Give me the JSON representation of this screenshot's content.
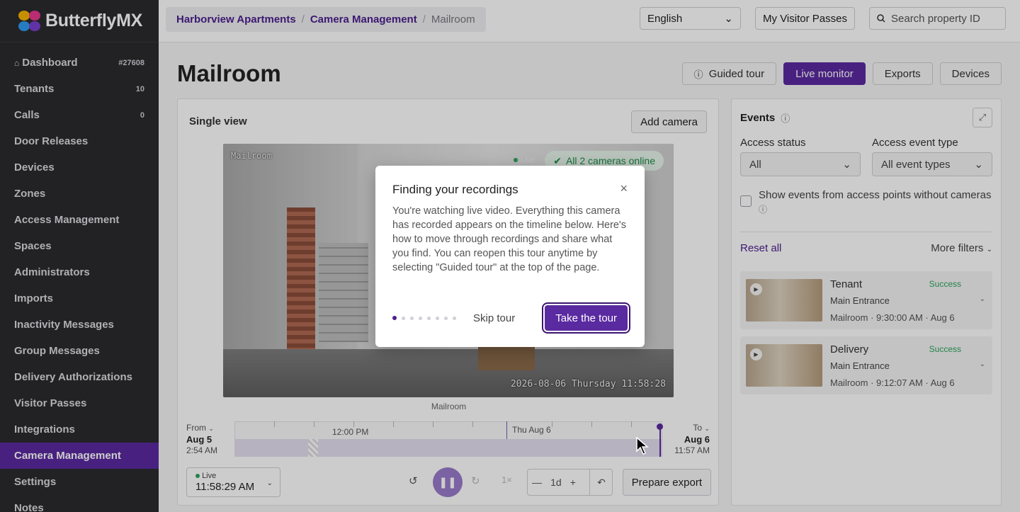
{
  "brand": {
    "name": "ButterflyMX"
  },
  "sidebar": {
    "items": [
      {
        "label": "Dashboard",
        "count": "#27608",
        "icon": "home-icon"
      },
      {
        "label": "Tenants",
        "count": "10"
      },
      {
        "label": "Calls",
        "count": "0"
      },
      {
        "label": "Door Releases"
      },
      {
        "label": "Devices"
      },
      {
        "label": "Zones"
      },
      {
        "label": "Access Management"
      },
      {
        "label": "Spaces"
      },
      {
        "label": "Administrators"
      },
      {
        "label": "Imports"
      },
      {
        "label": "Inactivity Messages"
      },
      {
        "label": "Group Messages"
      },
      {
        "label": "Delivery Authorizations"
      },
      {
        "label": "Visitor Passes"
      },
      {
        "label": "Integrations"
      },
      {
        "label": "Camera Management",
        "active": true
      },
      {
        "label": "Settings"
      },
      {
        "label": "Notes"
      }
    ]
  },
  "topbar": {
    "breadcrumb": [
      "Harborview Apartments",
      "Camera Management",
      "Mailroom"
    ],
    "language": "English",
    "visitor_passes": "My Visitor Passes",
    "search_placeholder": "Search property ID"
  },
  "page": {
    "title": "Mailroom",
    "actions": {
      "guided_tour": "Guided tour",
      "live_monitor": "Live monitor",
      "exports": "Exports",
      "devices": "Devices"
    }
  },
  "video": {
    "card_title": "Single view",
    "add_camera": "Add camera",
    "camera_label": "Mailroom",
    "live_tag": "Live",
    "online_status": "All 2 cameras online",
    "timestamp": "2026-08-06 Thursday 11:58:28",
    "caption": "Mailroom"
  },
  "timeline": {
    "from_label": "From",
    "from_date": "Aug 5",
    "from_time": "2:54 AM",
    "to_label": "To",
    "to_date": "Aug 6",
    "to_time": "11:57 AM",
    "marker_noon": "12:00 PM",
    "marker_day": "Thu Aug 6"
  },
  "controls": {
    "live_label": "Live",
    "live_time": "11:58:29 AM",
    "speed": "1×",
    "zoom_value": "1d",
    "prepare_export": "Prepare export"
  },
  "events": {
    "title": "Events",
    "access_status_label": "Access status",
    "access_status_value": "All",
    "event_type_label": "Access event type",
    "event_type_value": "All event types",
    "show_without_cameras": "Show events from access points without cameras",
    "reset_all": "Reset all",
    "more_filters": "More filters",
    "items": [
      {
        "title": "Tenant",
        "status": "Success",
        "location": "Main Entrance",
        "meta": "Mailroom · 9:30:00 AM · Aug 6"
      },
      {
        "title": "Delivery",
        "status": "Success",
        "location": "Main Entrance",
        "meta": "Mailroom · 9:12:07 AM · Aug 6"
      }
    ]
  },
  "modal": {
    "title": "Finding your recordings",
    "body": "You're watching live video. Everything this camera has recorded appears on the timeline below. Here's how to move through recordings and share what you find. You can reopen this tour anytime by selecting \"Guided tour\" at the top of the page.",
    "skip": "Skip tour",
    "take": "Take the tour",
    "step_total": 8,
    "step_current": 1
  },
  "colors": {
    "accent": "#5a2aa0",
    "sidebar": "#2b2b2f",
    "success": "#2ea45a"
  }
}
